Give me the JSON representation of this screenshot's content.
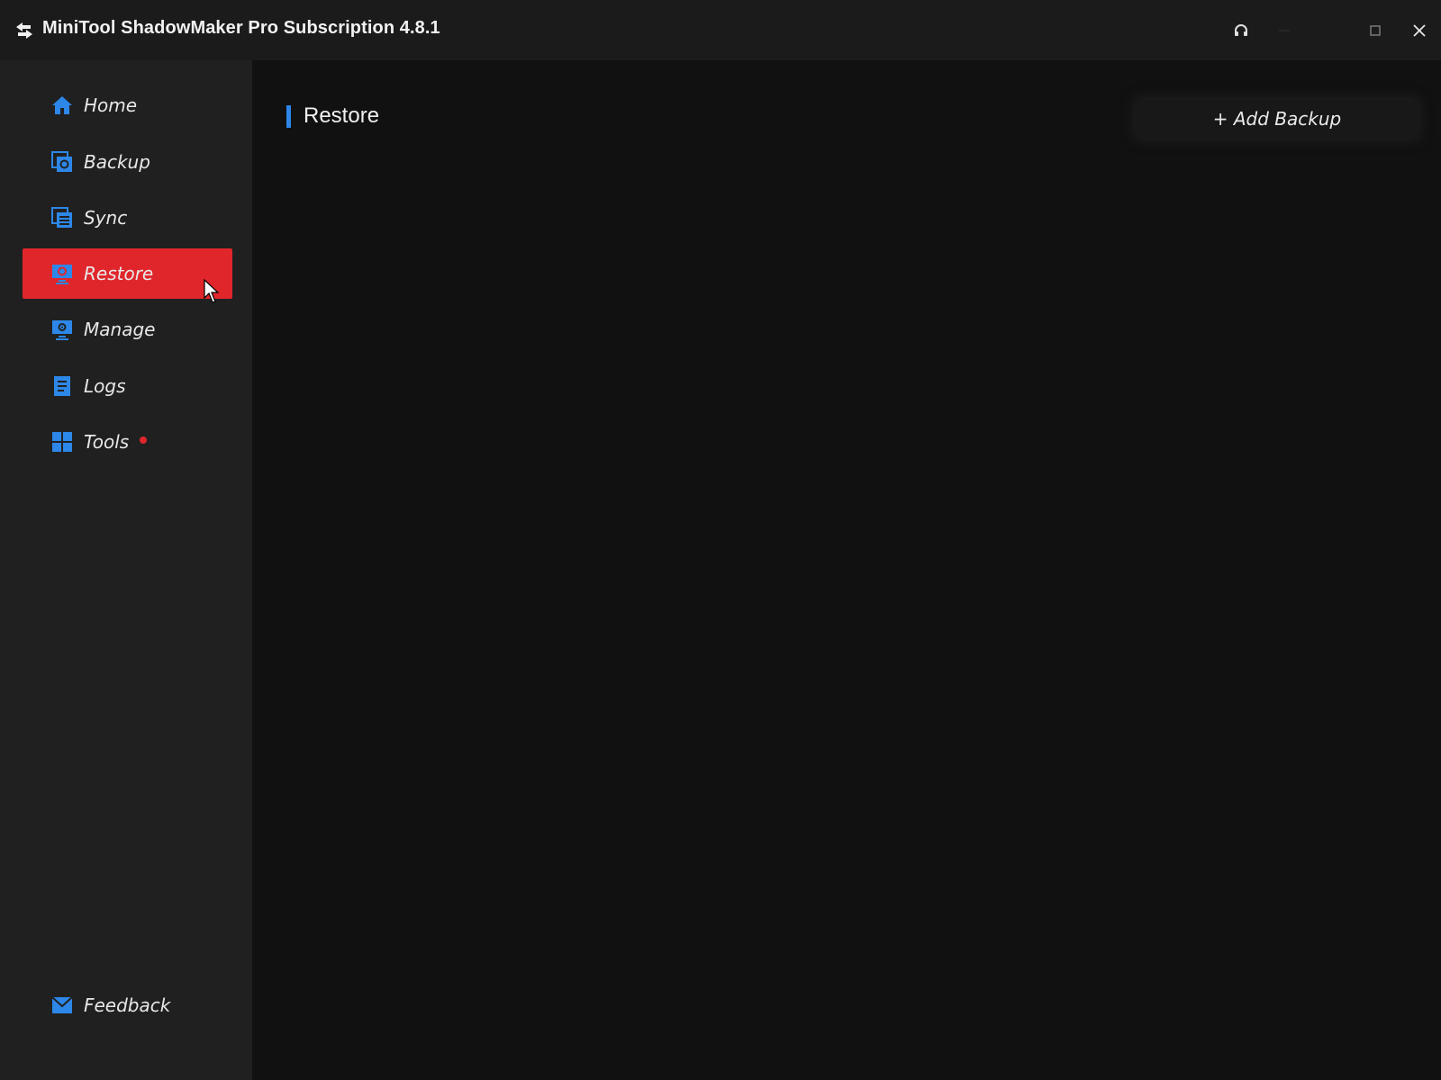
{
  "window": {
    "title": "MiniTool ShadowMaker Pro Subscription 4.8.1",
    "logo_icon": "minitool-logo-icon",
    "controls": [
      {
        "name": "support-headset-icon"
      },
      {
        "name": "minimize-icon"
      },
      {
        "name": "maximize-icon"
      },
      {
        "name": "close-icon"
      }
    ]
  },
  "sidebar": {
    "items": [
      {
        "label": "Home",
        "icon": "home-icon",
        "active": false
      },
      {
        "label": "Backup",
        "icon": "backup-icon",
        "active": false
      },
      {
        "label": "Sync",
        "icon": "sync-icon",
        "active": false
      },
      {
        "label": "Restore",
        "icon": "restore-icon",
        "active": true
      },
      {
        "label": "Manage",
        "icon": "manage-icon",
        "active": false
      },
      {
        "label": "Logs",
        "icon": "logs-icon",
        "active": false
      },
      {
        "label": "Tools",
        "icon": "tools-icon",
        "active": false,
        "badge": "red-dot"
      }
    ],
    "feedback": {
      "label": "Feedback",
      "icon": "mail-icon"
    }
  },
  "main": {
    "title": "Restore",
    "add_backup_label": "+ Add Backup"
  },
  "colors": {
    "accent_blue": "#2d87e8",
    "active_red": "#e0262b",
    "sidebar_bg": "#202020",
    "main_bg": "#111111"
  }
}
